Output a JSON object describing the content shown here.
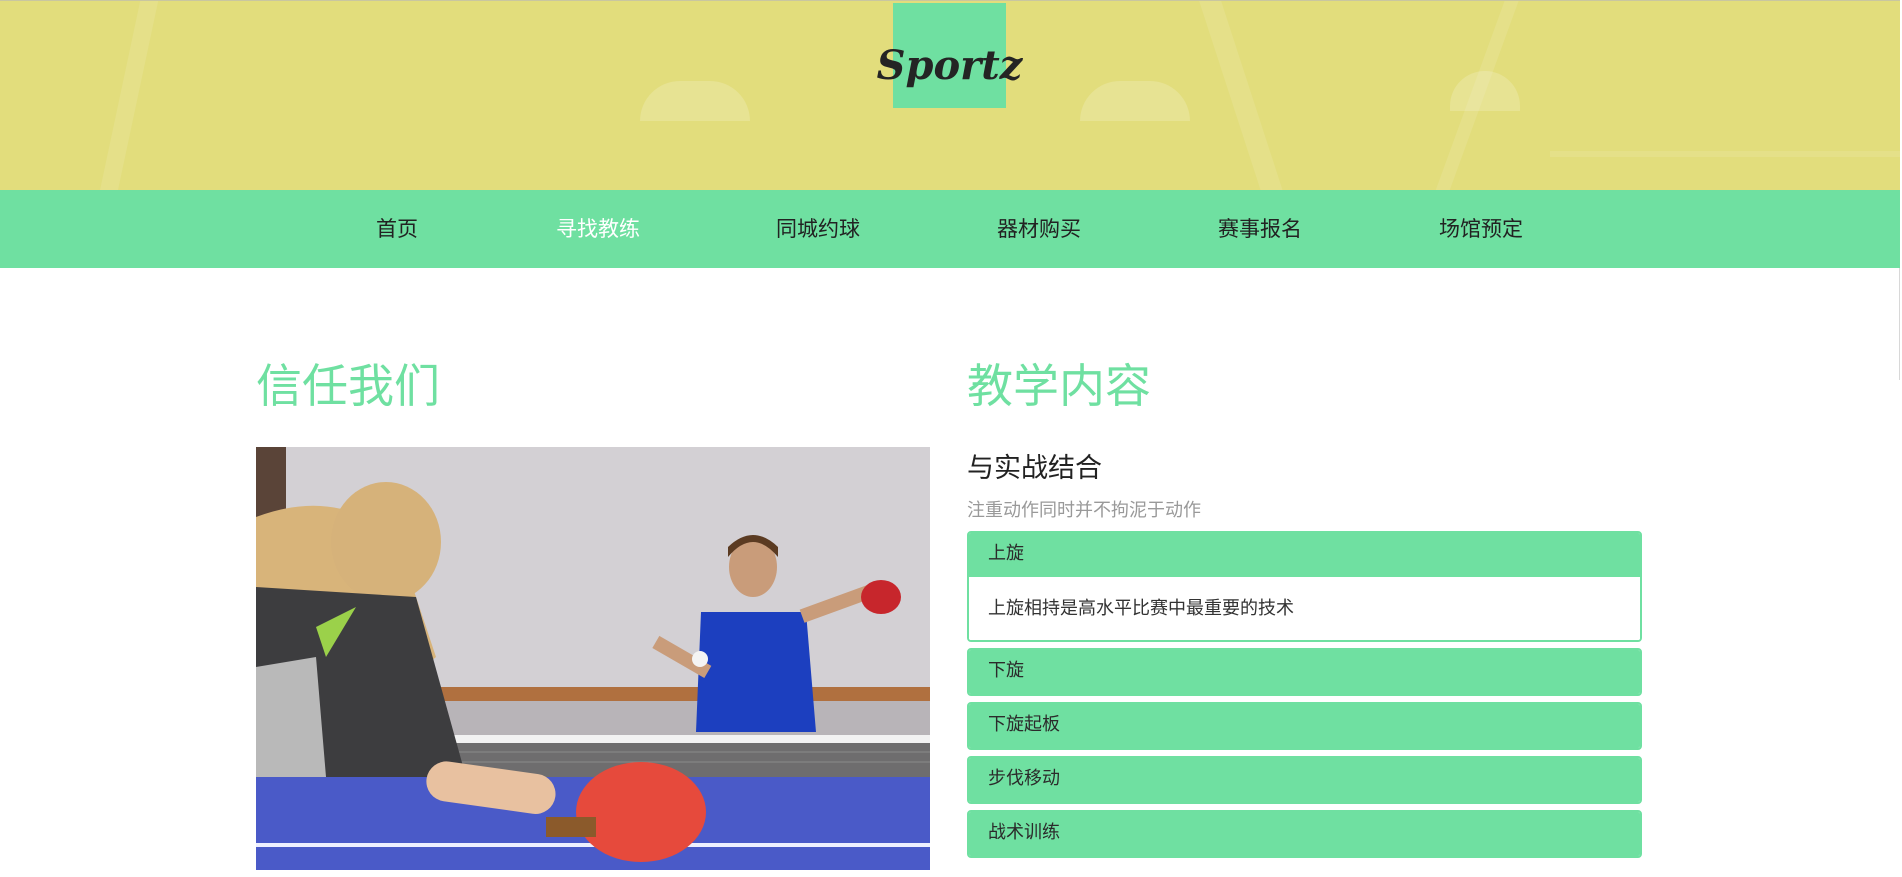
{
  "header": {
    "logo_text": "Sportz"
  },
  "nav": {
    "items": [
      {
        "label": "首页",
        "active": false
      },
      {
        "label": "寻找教练",
        "active": true
      },
      {
        "label": "同城约球",
        "active": false
      },
      {
        "label": "器材购买",
        "active": false
      },
      {
        "label": "赛事报名",
        "active": false
      },
      {
        "label": "场馆预定",
        "active": false
      }
    ]
  },
  "left": {
    "title": "信任我们"
  },
  "right": {
    "title": "教学内容",
    "subheading": "与实战结合",
    "subtext": "注重动作同时并不拘泥于动作",
    "accordion": [
      {
        "label": "上旋",
        "body": "上旋相持是高水平比赛中最重要的技术",
        "expanded": true
      },
      {
        "label": "下旋",
        "expanded": false
      },
      {
        "label": "下旋起板",
        "expanded": false
      },
      {
        "label": "步伐移动",
        "expanded": false
      },
      {
        "label": "战术训练",
        "expanded": false
      }
    ]
  },
  "colors": {
    "banner": "#e2dd7c",
    "accent": "#6fe0a1",
    "nav_active_text": "#ffffff"
  }
}
